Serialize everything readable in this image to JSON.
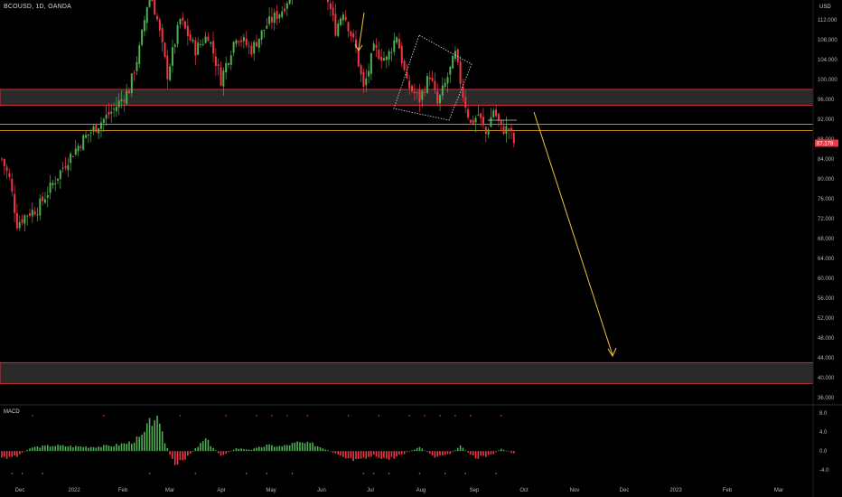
{
  "header": {
    "symbol": "BCOUSD, 1D, OANDA",
    "currency": "USD"
  },
  "price_badge": "87.178",
  "macd_label": "MACD",
  "colors": {
    "up": "#4caf50",
    "down": "#f23645",
    "zone_border": "#f23645",
    "zone_fill": "#2a2a2a",
    "fib_line": "#e0a020",
    "arrow": "#f0c040",
    "bg": "#000000"
  },
  "chart_data": [
    {
      "type": "candlestick",
      "title": "BCOUSD, 1D, OANDA",
      "y_axis": {
        "ticks": [
          "36.000",
          "40.000",
          "44.000",
          "48.000",
          "52.000",
          "56.000",
          "60.000",
          "64.000",
          "68.000",
          "72.000",
          "76.000",
          "80.000",
          "84.000",
          "88.000",
          "92.000",
          "96.000",
          "100.000",
          "104.000",
          "108.000",
          "112.000"
        ],
        "ylim": [
          34.5,
          116
        ],
        "unit": "USD"
      },
      "x_axis": {
        "ticks": [
          "Dec",
          "2022",
          "Feb",
          "Mar",
          "Apr",
          "May",
          "Jun",
          "Jul",
          "Aug",
          "Sep",
          "Oct",
          "Nov",
          "Dec",
          "2023",
          "Feb",
          "Mar"
        ]
      },
      "last_price": 87.178,
      "trend_anchors": [
        {
          "t": 0,
          "p": 84
        },
        {
          "t": 3,
          "p": 80
        },
        {
          "t": 6,
          "p": 71
        },
        {
          "t": 10,
          "p": 73
        },
        {
          "t": 14,
          "p": 74
        },
        {
          "t": 20,
          "p": 79
        },
        {
          "t": 26,
          "p": 84
        },
        {
          "t": 32,
          "p": 88
        },
        {
          "t": 38,
          "p": 91
        },
        {
          "t": 44,
          "p": 94
        },
        {
          "t": 50,
          "p": 98
        },
        {
          "t": 54,
          "p": 106
        },
        {
          "t": 58,
          "p": 118
        },
        {
          "t": 61,
          "p": 112
        },
        {
          "t": 65,
          "p": 101
        },
        {
          "t": 70,
          "p": 112
        },
        {
          "t": 76,
          "p": 106
        },
        {
          "t": 81,
          "p": 109
        },
        {
          "t": 86,
          "p": 100
        },
        {
          "t": 92,
          "p": 109
        },
        {
          "t": 98,
          "p": 106
        },
        {
          "t": 104,
          "p": 111
        },
        {
          "t": 110,
          "p": 114
        },
        {
          "t": 116,
          "p": 120
        },
        {
          "t": 122,
          "p": 122
        },
        {
          "t": 127,
          "p": 118
        },
        {
          "t": 131,
          "p": 110
        },
        {
          "t": 134,
          "p": 114
        },
        {
          "t": 139,
          "p": 106
        },
        {
          "t": 142,
          "p": 98
        },
        {
          "t": 146,
          "p": 106
        },
        {
          "t": 151,
          "p": 104
        },
        {
          "t": 155,
          "p": 109
        },
        {
          "t": 159,
          "p": 99
        },
        {
          "t": 164,
          "p": 96
        },
        {
          "t": 168,
          "p": 101
        },
        {
          "t": 171,
          "p": 95
        },
        {
          "t": 174,
          "p": 99
        },
        {
          "t": 178,
          "p": 105
        },
        {
          "t": 181,
          "p": 97
        },
        {
          "t": 184,
          "p": 91
        },
        {
          "t": 187,
          "p": 93
        },
        {
          "t": 190,
          "p": 89
        },
        {
          "t": 193,
          "p": 94
        },
        {
          "t": 196,
          "p": 90
        },
        {
          "t": 199,
          "p": 90
        },
        {
          "t": 201,
          "p": 87.2
        }
      ],
      "zones": [
        {
          "name": "resistance-zone",
          "from": 94.8,
          "to": 98.0
        },
        {
          "name": "target-zone",
          "from": 38.8,
          "to": 43.0
        }
      ],
      "horizontal_lines": [
        91.0,
        89.7
      ],
      "projection_arrow": {
        "from_date": "late Sep 2022",
        "from_price": 95.5,
        "to_date": "late Nov 2022",
        "to_price": 44.5
      }
    },
    {
      "type": "bar",
      "title": "MACD",
      "y_axis": {
        "ticks": [
          "8.0",
          "4.0",
          "0.0",
          "-4.0"
        ],
        "ylim": [
          -5.5,
          9
        ]
      },
      "histogram_anchors": [
        {
          "t": 0,
          "v": -1.5
        },
        {
          "t": 6,
          "v": -1.0
        },
        {
          "t": 12,
          "v": 0.8
        },
        {
          "t": 20,
          "v": 1.2
        },
        {
          "t": 28,
          "v": 1.0
        },
        {
          "t": 36,
          "v": 0.9
        },
        {
          "t": 44,
          "v": 1.2
        },
        {
          "t": 50,
          "v": 1.8
        },
        {
          "t": 55,
          "v": 3.0
        },
        {
          "t": 60,
          "v": 7.5
        },
        {
          "t": 64,
          "v": 2.0
        },
        {
          "t": 68,
          "v": -3.5
        },
        {
          "t": 74,
          "v": -0.5
        },
        {
          "t": 80,
          "v": 2.5
        },
        {
          "t": 86,
          "v": -1.0
        },
        {
          "t": 92,
          "v": 0.6
        },
        {
          "t": 98,
          "v": 0.3
        },
        {
          "t": 104,
          "v": 1.2
        },
        {
          "t": 110,
          "v": 1.0
        },
        {
          "t": 116,
          "v": 1.8
        },
        {
          "t": 122,
          "v": 1.5
        },
        {
          "t": 128,
          "v": 0.2
        },
        {
          "t": 134,
          "v": -1.5
        },
        {
          "t": 140,
          "v": -2.2
        },
        {
          "t": 146,
          "v": -1.0
        },
        {
          "t": 152,
          "v": -1.8
        },
        {
          "t": 158,
          "v": -0.5
        },
        {
          "t": 164,
          "v": 0.8
        },
        {
          "t": 170,
          "v": -1.2
        },
        {
          "t": 176,
          "v": -0.5
        },
        {
          "t": 180,
          "v": 1.0
        },
        {
          "t": 186,
          "v": -1.5
        },
        {
          "t": 192,
          "v": -0.9
        },
        {
          "t": 196,
          "v": 0.5
        },
        {
          "t": 201,
          "v": -0.6
        }
      ],
      "signal_dots_above": [
        12,
        40,
        70,
        88,
        100,
        106,
        112,
        120,
        136,
        148,
        160,
        166,
        172,
        178,
        184,
        196
      ],
      "signal_dots_below": [
        4,
        8,
        16,
        58,
        76,
        96,
        104,
        114,
        142,
        146,
        152,
        164,
        174,
        182,
        194
      ]
    }
  ]
}
